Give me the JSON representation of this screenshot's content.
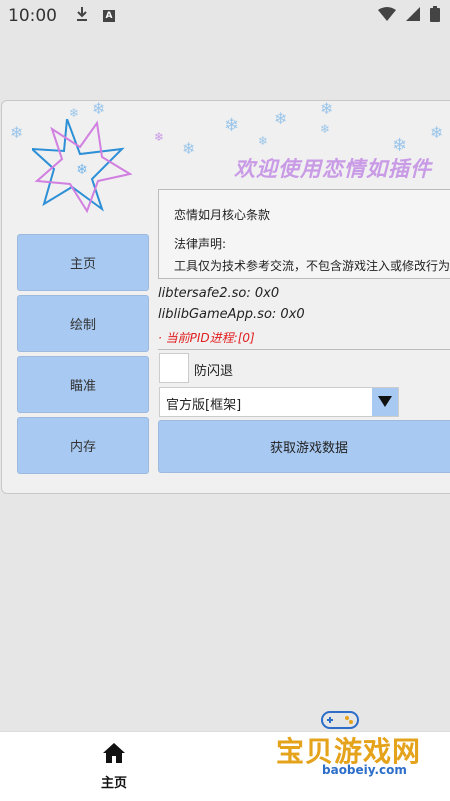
{
  "status_bar": {
    "time": "10:00"
  },
  "app": {
    "welcome": "欢迎使用恋情如插件",
    "side_nav": [
      {
        "label": "主页"
      },
      {
        "label": "绘制"
      },
      {
        "label": "瞄准"
      },
      {
        "label": "内存"
      }
    ],
    "info": {
      "title": "恋情如月核心条款",
      "legal_heading": "法律声明:",
      "legal_text": "工具仅为技术参考交流，不包含游戏注入或修改行为"
    },
    "libs": [
      {
        "text": "libtersafe2.so: 0x0"
      },
      {
        "text": "liblibGameApp.so: 0x0"
      }
    ],
    "pid_text": "· 当前PID进程:[0]",
    "anti_flash_label": "防闪退",
    "version_select": {
      "value": "官方版[框架]"
    },
    "fetch_button": "获取游戏数据"
  },
  "bottom_nav": {
    "home_label": "主页"
  },
  "watermark": {
    "text": "宝贝游戏网",
    "url": "baobeiy.com"
  },
  "colors": {
    "button_blue": "#a8c9f2",
    "accent_pink": "#c99be6",
    "pid_red": "#e02020",
    "watermark_gold": "#e5a21b"
  }
}
